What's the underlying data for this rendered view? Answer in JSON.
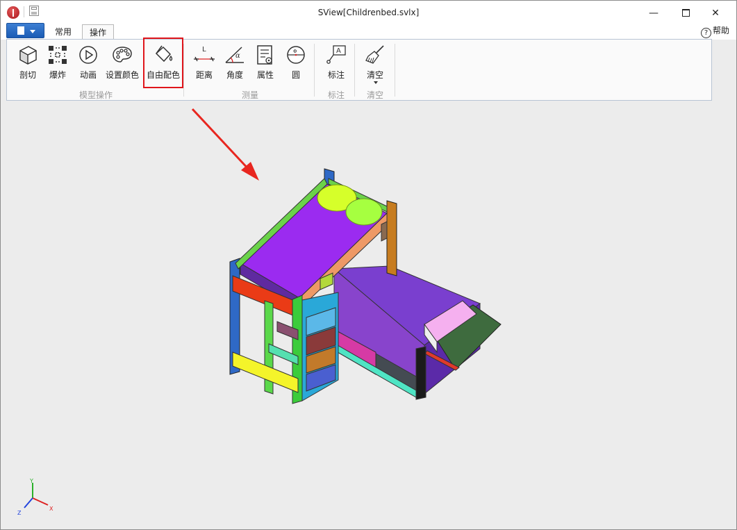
{
  "window": {
    "title": "SView[Childrenbed.svlx]",
    "minimize_glyph": "—",
    "maximize_glyph": "☐",
    "close_glyph": "✕"
  },
  "tabs": [
    {
      "label": "常用",
      "active": false
    },
    {
      "label": "操作",
      "active": true
    }
  ],
  "help": {
    "icon": "question-circle-icon",
    "label": "帮助"
  },
  "ribbon": {
    "groups": [
      {
        "label": "模型操作",
        "buttons": [
          "剖切",
          "爆炸",
          "动画",
          "设置颜色",
          "自由配色"
        ]
      },
      {
        "label": "测量",
        "buttons": [
          "距离",
          "角度",
          "属性",
          "圆"
        ]
      },
      {
        "label": "标注",
        "buttons": [
          "标注"
        ]
      },
      {
        "label": "清空",
        "buttons": [
          "清空"
        ]
      }
    ],
    "highlighted_button": "自由配色",
    "highlight_color": "#e0151b"
  },
  "icons": {
    "section": "cube-section-icon",
    "explode": "explode-icon",
    "animation": "play-circle-icon",
    "set_color": "palette-icon",
    "free_color": "paint-bucket-icon",
    "distance": "distance-icon",
    "angle": "angle-icon",
    "properties": "properties-icon",
    "circle": "circle-measure-icon",
    "annotate": "annotation-icon",
    "clear": "broom-icon"
  },
  "axis_triad": {
    "x": "X",
    "y": "Y",
    "z": "Z"
  },
  "colors": {
    "accent_blue": "#1b5cb5",
    "viewport_bg": "#ececec",
    "arrow_red": "#e8261f"
  }
}
